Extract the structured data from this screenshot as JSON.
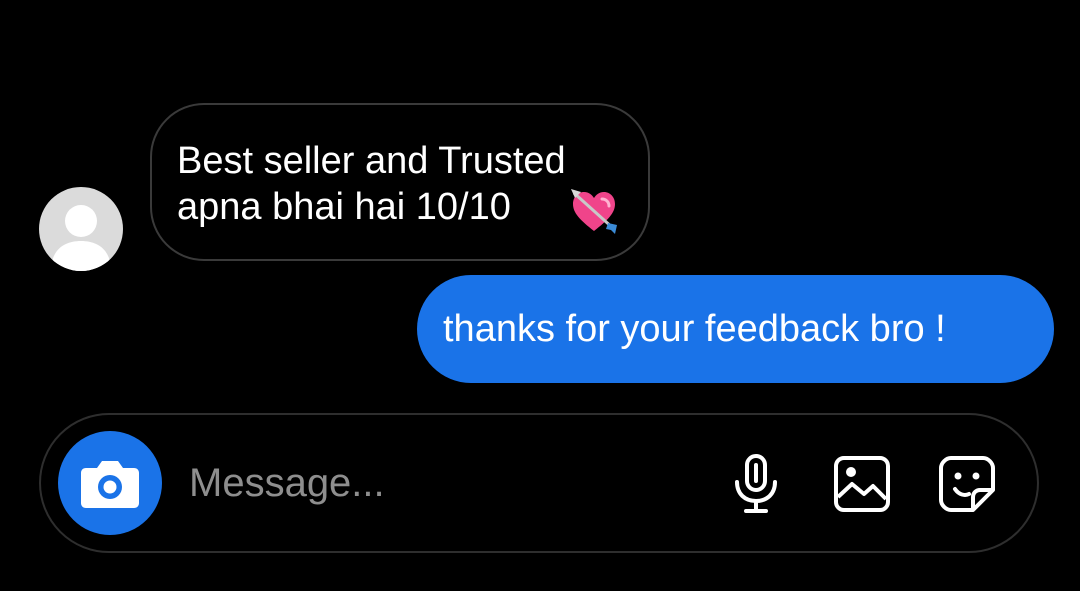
{
  "conversation": {
    "incoming_message": "Best seller and Trusted\napna bhai hai 10/10",
    "incoming_emoji": "heart-with-arrow-emoji",
    "outgoing_message": "thanks for your feedback bro !"
  },
  "composer": {
    "placeholder": "Message...",
    "icons": [
      "camera-icon",
      "microphone-icon",
      "gallery-icon",
      "sticker-icon"
    ]
  },
  "colors": {
    "background": "#000000",
    "accent_blue": "#1a73e8",
    "incoming_border": "#3a3a3a",
    "placeholder": "#8e8e8e",
    "heart_pink": "#f0448a"
  }
}
